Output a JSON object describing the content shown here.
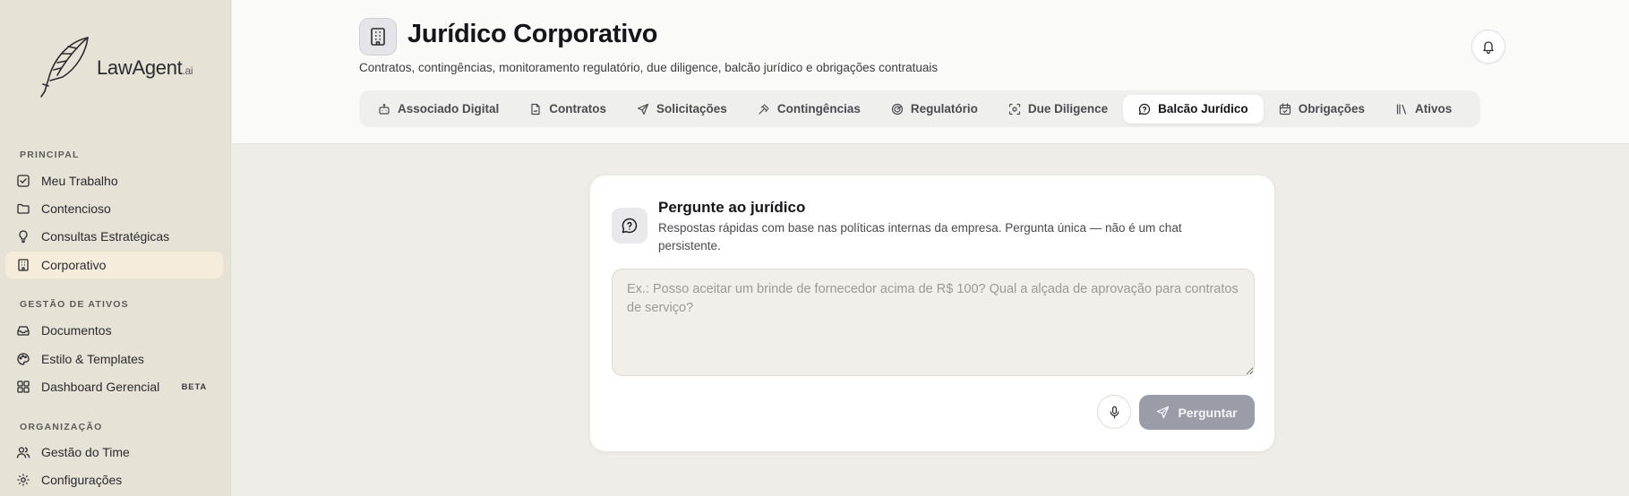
{
  "brand": {
    "name": "LawAgent",
    "suffix": ".ai"
  },
  "sidebar": {
    "sections": [
      {
        "label": "PRINCIPAL"
      },
      {
        "label": "GESTÃO DE ATIVOS"
      },
      {
        "label": "ORGANIZAÇÃO"
      }
    ],
    "items": [
      {
        "label": "Meu Trabalho",
        "icon": "check-square-icon"
      },
      {
        "label": "Contencioso",
        "icon": "folder-icon"
      },
      {
        "label": "Consultas Estratégicas",
        "icon": "lightbulb-icon"
      },
      {
        "label": "Corporativo",
        "icon": "building-icon",
        "active": true
      },
      {
        "label": "Documentos",
        "icon": "inbox-icon"
      },
      {
        "label": "Estilo & Templates",
        "icon": "palette-icon"
      },
      {
        "label": "Dashboard Gerencial",
        "icon": "dashboard-icon",
        "badge": "BETA"
      },
      {
        "label": "Gestão do Time",
        "icon": "users-icon"
      },
      {
        "label": "Configurações",
        "icon": "gear-icon"
      }
    ]
  },
  "header": {
    "title": "Jurídico Corporativo",
    "subtitle": "Contratos, contingências, monitoramento regulatório, due diligence, balcão jurídico e obrigações contratuais",
    "tabs": [
      {
        "label": "Associado Digital",
        "icon": "bot-icon"
      },
      {
        "label": "Contratos",
        "icon": "file-signature-icon"
      },
      {
        "label": "Solicitações",
        "icon": "send-icon"
      },
      {
        "label": "Contingências",
        "icon": "gavel-icon"
      },
      {
        "label": "Regulatório",
        "icon": "radar-icon"
      },
      {
        "label": "Due Diligence",
        "icon": "scan-icon"
      },
      {
        "label": "Balcão Jurídico",
        "icon": "message-question-icon",
        "active": true
      },
      {
        "label": "Obrigações",
        "icon": "calendar-check-icon"
      },
      {
        "label": "Ativos",
        "icon": "library-icon"
      }
    ]
  },
  "ask_card": {
    "title": "Pergunte ao jurídico",
    "description": "Respostas rápidas com base nas políticas internas da empresa. Pergunta única — não é um chat persistente.",
    "placeholder": "Ex.: Posso aceitar um brinde de fornecedor acima de R$ 100? Qual a alçada de aprovação para contratos de serviço?",
    "value": "",
    "submit_label": "Perguntar"
  },
  "colors": {
    "sidebar_bg": "#e6e2d6",
    "active_nav": "#f5ecdc",
    "page_bg": "#efede7",
    "button_disabled": "#9a9ca8"
  }
}
